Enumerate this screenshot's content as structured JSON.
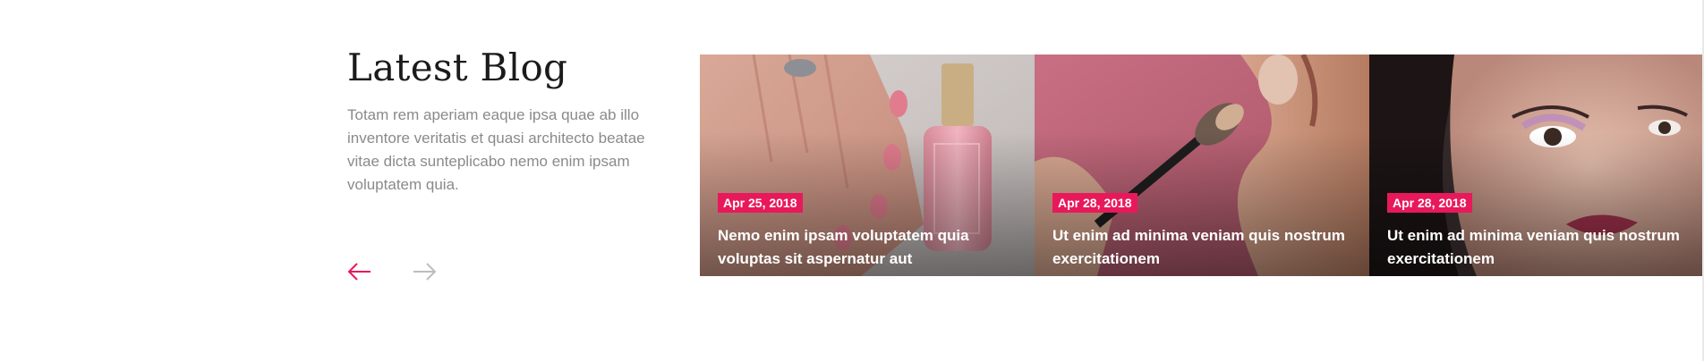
{
  "section": {
    "title": "Latest Blog",
    "description": "Totam rem aperiam eaque ipsa quae ab illo inventore veritatis et quasi architecto beatae vitae dicta sunteplicabo nemo enim ipsam voluptatem quia."
  },
  "nav": {
    "prev_icon": "arrow-left-icon",
    "next_icon": "arrow-right-icon",
    "prev_color": "#e8195a",
    "next_color": "#bdbdbd"
  },
  "colors": {
    "accent": "#e8195a",
    "heading": "#1b1b1b",
    "body_text": "#8a8a8a"
  },
  "posts": [
    {
      "date": "Apr 25, 2018",
      "title": "Nemo enim ipsam voluptatem quia voluptas sit aspernatur aut",
      "image": "nail-polish-image"
    },
    {
      "date": "Apr 28, 2018",
      "title": "Ut enim ad minima veniam quis nostrum exercitationem",
      "image": "makeup-brush-image"
    },
    {
      "date": "Apr 28, 2018",
      "title": "Ut enim ad minima veniam quis nostrum exercitationem",
      "image": "portrait-makeup-image"
    }
  ]
}
